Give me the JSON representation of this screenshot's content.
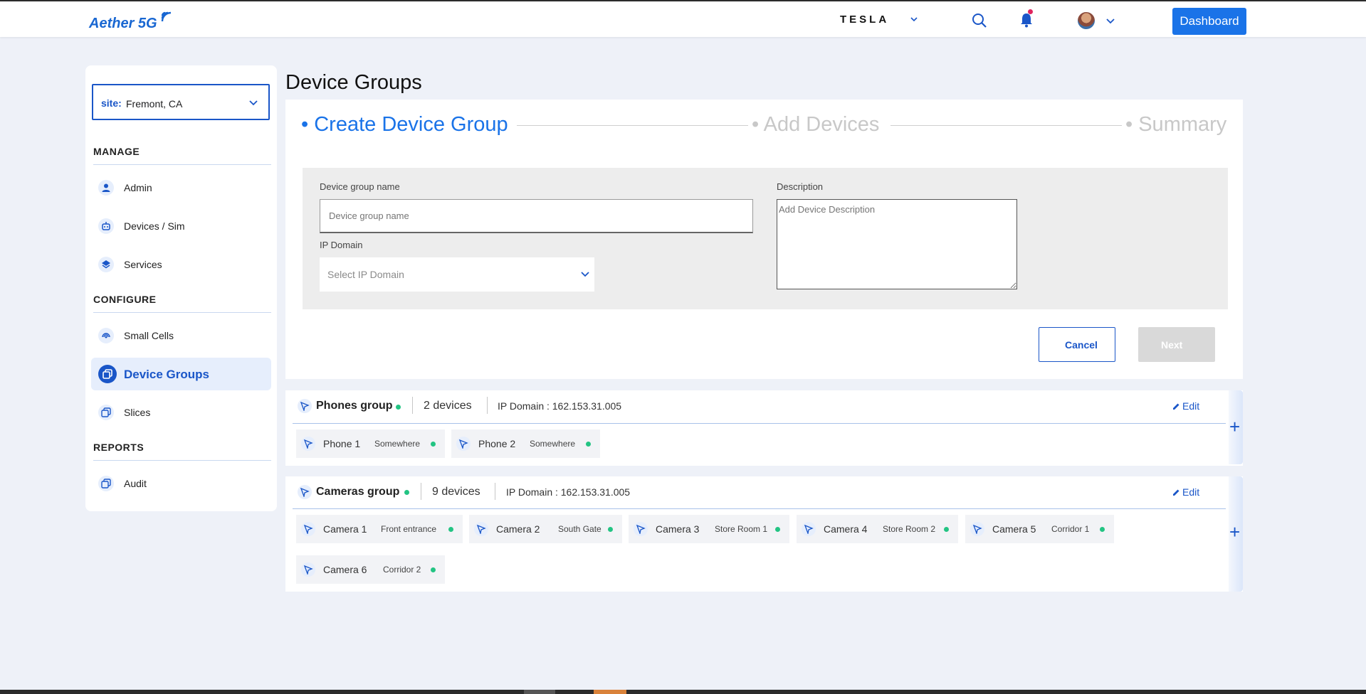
{
  "header": {
    "logo": "Aether 5G",
    "brand": "TESLA",
    "dashboard_label": "Dashboard"
  },
  "icons": {
    "logo": "wifi-waves-icon",
    "brand_dropdown": "chevron-down-icon",
    "search": "search-icon",
    "notifications": "bell-icon",
    "profile": "avatar",
    "profile_dropdown": "chevron-down-icon"
  },
  "colors": {
    "accent": "#1a73e8",
    "primary_dark": "#1a56c8",
    "status_online": "#23c483",
    "background": "#eef1f8"
  },
  "sidebar": {
    "site_label": "site:",
    "site_value": "Fremont, CA",
    "sections": [
      {
        "title": "MANAGE"
      },
      {
        "title": "CONFIGURE"
      },
      {
        "title": "REPORTS"
      }
    ],
    "items": [
      {
        "label": "Admin",
        "icon": "person-icon"
      },
      {
        "label": "Devices / Sim",
        "icon": "robot-icon"
      },
      {
        "label": "Services",
        "icon": "layers-icon"
      },
      {
        "label": "Small Cells",
        "icon": "signal-icon"
      },
      {
        "label": "Device Groups",
        "icon": "copy-icon",
        "active": true
      },
      {
        "label": "Slices",
        "icon": "copy-icon"
      },
      {
        "label": "Audit",
        "icon": "copy-icon"
      }
    ]
  },
  "main": {
    "title": "Device Groups",
    "steps": [
      {
        "label": "Create Device Group",
        "active": true
      },
      {
        "label": "Add Devices",
        "active": false
      },
      {
        "label": "Summary",
        "active": false
      }
    ],
    "form": {
      "name_label": "Device group name",
      "name_placeholder": "Device group name",
      "ip_label": "IP Domain",
      "ip_placeholder": "Select IP Domain",
      "desc_label": "Description",
      "desc_placeholder": "Add Device Description"
    },
    "cancel_label": "Cancel",
    "next_label": "Next"
  },
  "groups": [
    {
      "name": "Phones group",
      "count": "2 devices",
      "ip": "IP Domain : 162.153.31.005",
      "edit_label": "Edit",
      "add_label": "+",
      "devices": [
        {
          "name": "Phone 1",
          "location": "Somewhere"
        },
        {
          "name": "Phone 2",
          "location": "Somewhere"
        }
      ]
    },
    {
      "name": "Cameras group",
      "count": "9 devices",
      "ip": "IP Domain : 162.153.31.005",
      "edit_label": "Edit",
      "add_label": "+",
      "devices": [
        {
          "name": "Camera 1",
          "location": "Front entrance"
        },
        {
          "name": "Camera 2",
          "location": "South Gate"
        },
        {
          "name": "Camera 3",
          "location": "Store Room 1"
        },
        {
          "name": "Camera 4",
          "location": "Store Room 2"
        },
        {
          "name": "Camera 5",
          "location": "Corridor 1"
        },
        {
          "name": "Camera 6",
          "location": "Corridor 2"
        }
      ]
    }
  ]
}
